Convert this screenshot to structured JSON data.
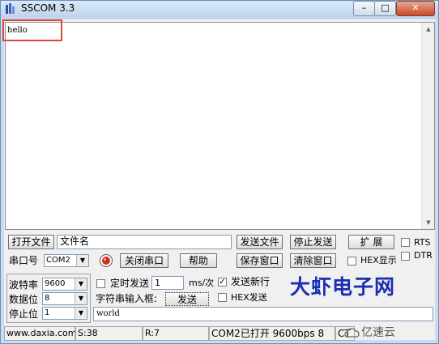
{
  "window": {
    "title": "SSCOM 3.3",
    "min": "–",
    "max": "□",
    "close": "✕"
  },
  "receive": {
    "text": "hello"
  },
  "file_row": {
    "open_file": "打开文件",
    "file_name": "文件名",
    "send_file": "发送文件",
    "stop_send": "停止发送",
    "expand": "扩 展",
    "rts": "RTS",
    "dtr": "DTR"
  },
  "port_row": {
    "port_label": "串口号",
    "port_value": "COM2",
    "close_port": "关闭串口",
    "help": "帮助",
    "save_window": "保存窗口",
    "clear_window": "清除窗口",
    "hex_display": "HEX显示"
  },
  "settings": {
    "baud_label": "波特率",
    "baud_value": "9600",
    "databits_label": "数据位",
    "databits_value": "8",
    "stopbits_label": "停止位",
    "stopbits_value": "1",
    "timed_send": "定时发送",
    "interval": "1",
    "interval_unit": "ms/次",
    "send_newline": "发送新行",
    "string_input_label": "字符串输入框:",
    "send_button": "发送",
    "hex_send": "HEX发送",
    "input_value": "world"
  },
  "brand_text": "大虾电子网",
  "status": {
    "site": "www.daxia.com",
    "sent": "S:38",
    "received": "R:7",
    "port_state": "COM2已打开  9600bps  8",
    "extra": "CT"
  },
  "watermark": "亿速云"
}
